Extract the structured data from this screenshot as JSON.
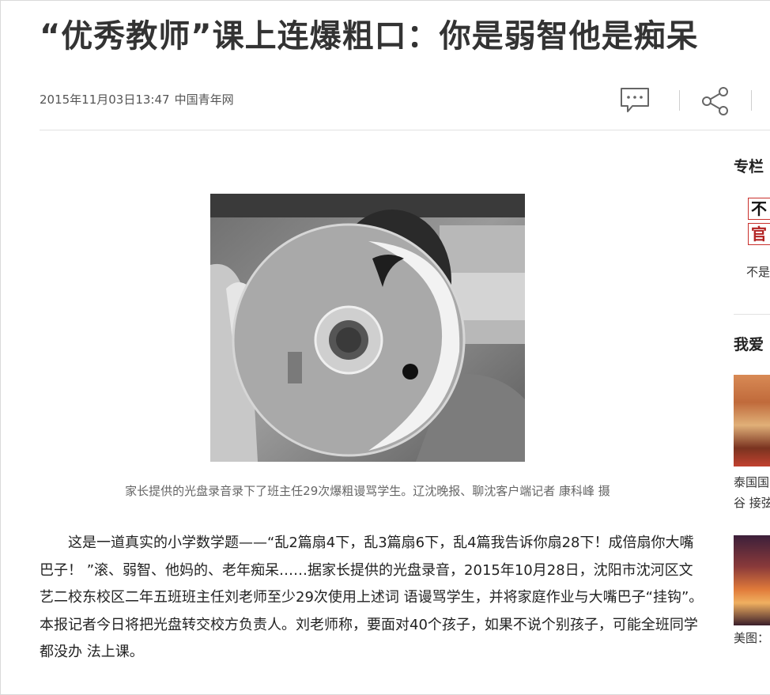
{
  "article": {
    "title": "“优秀教师”课上连爆粗口：你是弱智他是痴呆",
    "date": "2015年11月03日13:47",
    "source": "中国青年网",
    "image_caption": "家长提供的光盘录音录下了班主任29次爆粗谩骂学生。辽沈晚报、聊沈客户端记者 康科峰 摄",
    "body": "这是一道真实的小学数学题——“乱2篇扇4下，乱3篇扇6下，乱4篇我告诉你扇28下！成倍扇你大嘴巴子！ ”滚、弱智、他妈的、老年痴呆……据家长提供的光盘录音，2015年10月28日，沈阳市沈河区文艺二校东校区二年五班班主任刘老师至少29次使用上述词 语谩骂学生，并将家庭作业与大嘴巴子“挂钩”。本报记者今日将把光盘转交校方负责人。刘老师称，要面对40个孩子，如果不说个别孩子，可能全班同学都没办 法上课。"
  },
  "toolbar": {
    "comment_icon": "comment-icon",
    "share_icon": "share-icon"
  },
  "sidebar": {
    "column_title": "专栏",
    "column_logo_chars": [
      "不",
      "官"
    ],
    "column_name": "不是",
    "love_title": "我爱",
    "items": [
      {
        "caption_line1": "泰国国",
        "caption_line2": "谷 接弦"
      },
      {
        "caption_line1": "美图："
      }
    ]
  },
  "colors": {
    "title": "#333333",
    "meta": "#555555",
    "caption": "#666666",
    "logo_red": "#b22222"
  }
}
